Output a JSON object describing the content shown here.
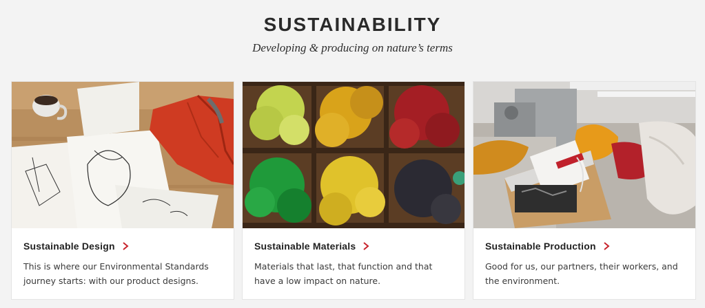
{
  "header": {
    "title": "SUSTAINABILITY",
    "subtitle": "Developing & producing on nature’s terms"
  },
  "cards": [
    {
      "title": "Sustainable Design",
      "description": "This is where our Environmental Standards journey starts: with our product designs."
    },
    {
      "title": "Sustainable Materials",
      "description": "Materials that last, that function and that have a low impact on nature."
    },
    {
      "title": "Sustainable Production",
      "description": "Good for us, our partners, their workers, and the environment."
    }
  ],
  "colors": {
    "accent": "#c8232c",
    "background": "#f3f3f3"
  },
  "icons": {
    "link_chevron": "chevron-right-icon"
  }
}
